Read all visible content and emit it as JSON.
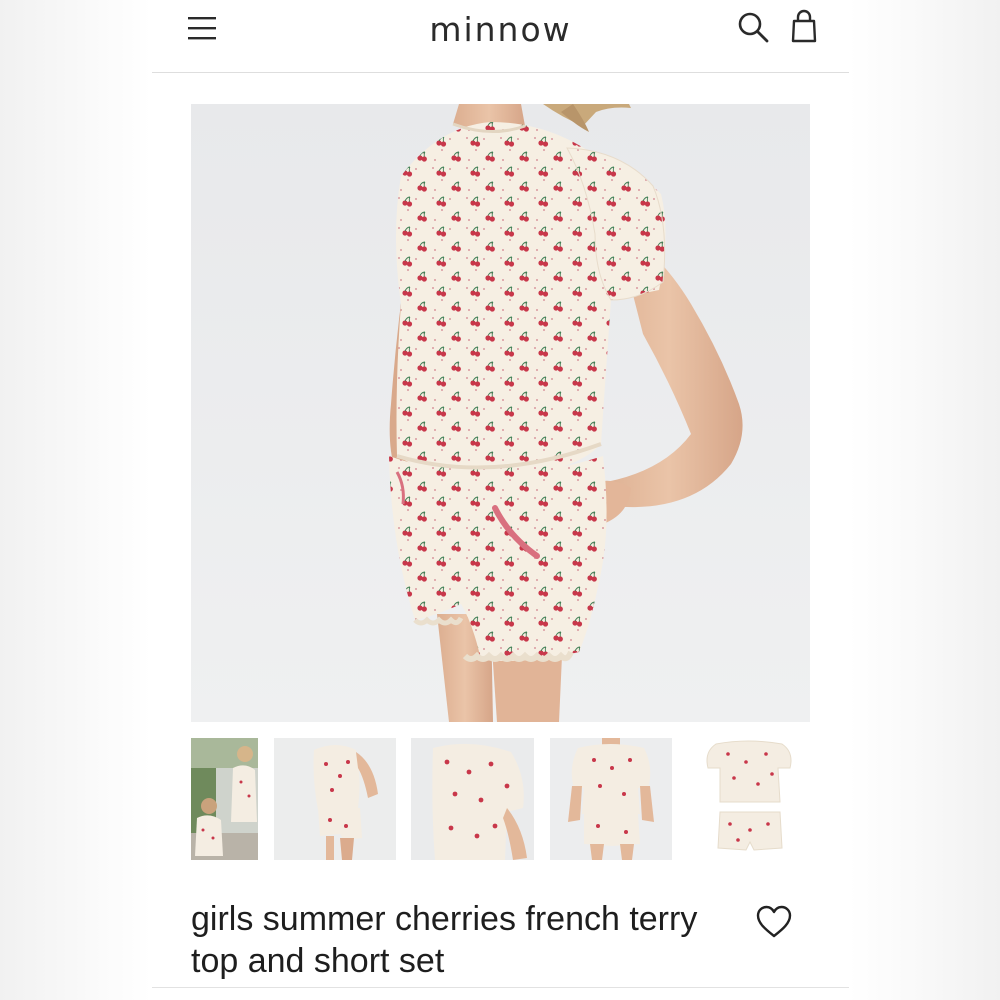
{
  "header": {
    "brand": "minnow",
    "icons": {
      "menu": "hamburger-menu-icon",
      "search": "search-icon",
      "bag": "shopping-bag-icon"
    }
  },
  "product": {
    "title_line1": "girls summer cherries french terry",
    "title_line2": "top and short set",
    "favorite_icon": "heart-outline-icon",
    "main_image": "girl wearing cherry print top and shorts, side view",
    "thumbnails": [
      "girls outdoors wearing cherry print outfits",
      "side view of cherry print set",
      "close-up of cherry print top",
      "front view of cherry print set",
      "flat lay of cherry print top and shorts"
    ]
  },
  "colors": {
    "fabric": "#f6efe3",
    "cherry": "#c8374a",
    "leaf": "#3f7f54",
    "pocket_trim": "#d9707f",
    "skin": "#e8c0a4",
    "text": "#1e1e1e"
  }
}
